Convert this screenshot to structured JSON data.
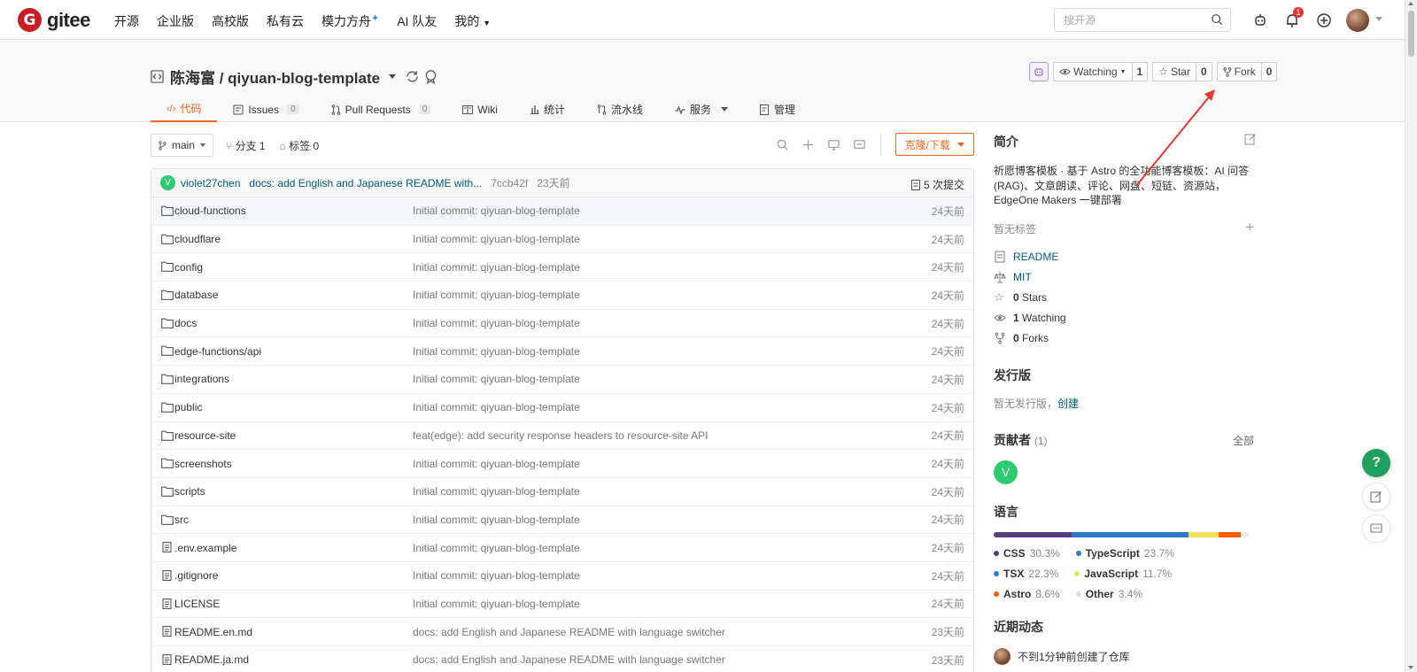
{
  "nav": {
    "logo_text": "gitee",
    "links": [
      "开源",
      "企业版",
      "高校版",
      "私有云",
      "模力方舟",
      "AI 队友",
      "我的"
    ],
    "search_placeholder": "搜开源",
    "notification_count": "1"
  },
  "repo": {
    "title": "陈海富 / qiyuan-blog-template",
    "watching_label": "Watching",
    "watching_count": "1",
    "star_label": "Star",
    "star_count": "0",
    "fork_label": "Fork",
    "fork_count": "0",
    "tabs": [
      {
        "label": "代码",
        "count": ""
      },
      {
        "label": "Issues",
        "count": "0"
      },
      {
        "label": "Pull Requests",
        "count": "0"
      },
      {
        "label": "Wiki",
        "count": ""
      },
      {
        "label": "统计",
        "count": ""
      },
      {
        "label": "流水线",
        "count": ""
      },
      {
        "label": "服务",
        "count": ""
      },
      {
        "label": "管理",
        "count": ""
      }
    ]
  },
  "branchbar": {
    "branch": "main",
    "branches": "分支 1",
    "tags": "标签 0",
    "clone_label": "克隆/下载"
  },
  "commit": {
    "avatar_letter": "V",
    "user": "violet27chen",
    "message": "docs: add English and Japanese README with...",
    "hash": "7ccb42f",
    "time": "23天前",
    "count": "5 次提交"
  },
  "files": [
    {
      "name": "cloud-functions",
      "type": "folder",
      "message": "Initial commit: qiyuan-blog-template",
      "time": "24天前"
    },
    {
      "name": "cloudflare",
      "type": "folder",
      "message": "Initial commit: qiyuan-blog-template",
      "time": "24天前"
    },
    {
      "name": "config",
      "type": "folder",
      "message": "Initial commit: qiyuan-blog-template",
      "time": "24天前"
    },
    {
      "name": "database",
      "type": "folder",
      "message": "Initial commit: qiyuan-blog-template",
      "time": "24天前"
    },
    {
      "name": "docs",
      "type": "folder",
      "message": "Initial commit: qiyuan-blog-template",
      "time": "24天前"
    },
    {
      "name": "edge-functions/api",
      "type": "folder",
      "message": "Initial commit: qiyuan-blog-template",
      "time": "24天前"
    },
    {
      "name": "integrations",
      "type": "folder",
      "message": "Initial commit: qiyuan-blog-template",
      "time": "24天前"
    },
    {
      "name": "public",
      "type": "folder",
      "message": "Initial commit: qiyuan-blog-template",
      "time": "24天前"
    },
    {
      "name": "resource-site",
      "type": "folder",
      "message": "feat(edge): add security response headers to resource-site API",
      "time": "24天前"
    },
    {
      "name": "screenshots",
      "type": "folder",
      "message": "Initial commit: qiyuan-blog-template",
      "time": "24天前"
    },
    {
      "name": "scripts",
      "type": "folder",
      "message": "Initial commit: qiyuan-blog-template",
      "time": "24天前"
    },
    {
      "name": "src",
      "type": "folder",
      "message": "Initial commit: qiyuan-blog-template",
      "time": "24天前"
    },
    {
      "name": ".env.example",
      "type": "file",
      "message": "Initial commit: qiyuan-blog-template",
      "time": "24天前"
    },
    {
      "name": ".gitignore",
      "type": "file",
      "message": "Initial commit: qiyuan-blog-template",
      "time": "24天前"
    },
    {
      "name": "LICENSE",
      "type": "file",
      "message": "Initial commit: qiyuan-blog-template",
      "time": "24天前"
    },
    {
      "name": "README.en.md",
      "type": "file",
      "message": "docs: add English and Japanese README with language switcher",
      "time": "23天前"
    },
    {
      "name": "README.ja.md",
      "type": "file",
      "message": "docs: add English and Japanese README with language switcher",
      "time": "23天前"
    }
  ],
  "sidebar": {
    "intro_title": "简介",
    "description": "祈愿博客模板 · 基于 Astro 的全功能博客模板：AI 问答 (RAG)、文章朗读、评论、网盘、短链、资源站，EdgeOne Makers 一键部署",
    "no_tags": "暂无标签",
    "readme": "README",
    "license": "MIT",
    "stars_num": "0",
    "stars_label": "Stars",
    "watching_num": "1",
    "watching_label": "Watching",
    "forks_num": "0",
    "forks_label": "Forks",
    "release_title": "发行版",
    "no_release": "暂无发行版，",
    "create": "创建",
    "contrib_title": "贡献者",
    "contrib_count": "(1)",
    "contrib_all": "全部",
    "contrib_avatar": "V",
    "lang_title": "语言",
    "languages": [
      {
        "name": "CSS",
        "percent": "30.3%",
        "value": 30.3,
        "color": "#563d7c"
      },
      {
        "name": "TypeScript",
        "percent": "23.7%",
        "value": 23.7,
        "color": "#3178c6"
      },
      {
        "name": "TSX",
        "percent": "22.3%",
        "value": 22.3,
        "color": "#3178c6"
      },
      {
        "name": "JavaScript",
        "percent": "11.7%",
        "value": 11.7,
        "color": "#f1e05a"
      },
      {
        "name": "Astro",
        "percent": "8.6%",
        "value": 8.6,
        "color": "#ff5a03"
      },
      {
        "name": "Other",
        "percent": "3.4%",
        "value": 3.4,
        "color": "#ededed"
      }
    ],
    "recent_title": "近期动态",
    "recent_item": "不到1分钟前创建了仓库"
  },
  "colors": {
    "accent": "#f26522",
    "brand": "#c71d23",
    "link": "#005980",
    "help": "#1fa05f"
  }
}
